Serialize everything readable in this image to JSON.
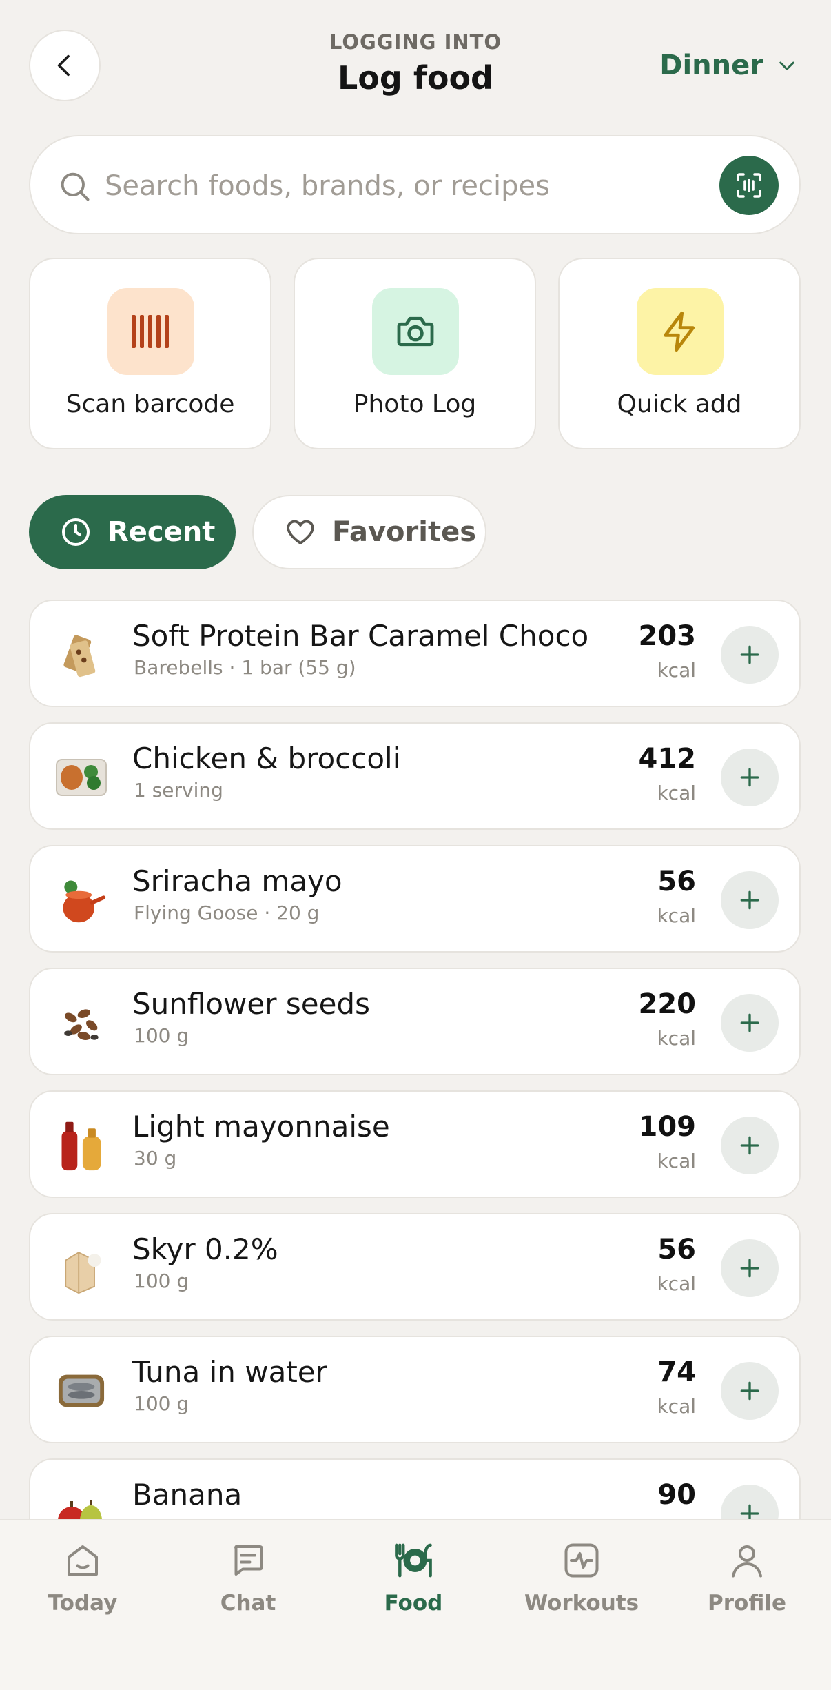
{
  "header": {
    "subtitle": "LOGGING INTO",
    "title": "Log food",
    "meal": "Dinner"
  },
  "search": {
    "placeholder": "Search foods, brands, or recipes"
  },
  "actions": [
    {
      "label": "Scan barcode",
      "icon": "barcode-icon"
    },
    {
      "label": "Photo Log",
      "icon": "camera-icon"
    },
    {
      "label": "Quick add",
      "icon": "lightning-icon"
    }
  ],
  "tabs": {
    "recent": "Recent",
    "favorites": "Favorites"
  },
  "foods": [
    {
      "name": "Soft Protein Bar Caramel Choco",
      "detail": "Barebells · 1 bar (55 g)",
      "kcal": "203",
      "unit": "kcal"
    },
    {
      "name": "Chicken & broccoli",
      "detail": "1 serving",
      "kcal": "412",
      "unit": "kcal"
    },
    {
      "name": "Sriracha mayo",
      "detail": "Flying Goose · 20 g",
      "kcal": "56",
      "unit": "kcal"
    },
    {
      "name": "Sunflower seeds",
      "detail": "100 g",
      "kcal": "220",
      "unit": "kcal"
    },
    {
      "name": "Light mayonnaise",
      "detail": "30 g",
      "kcal": "109",
      "unit": "kcal"
    },
    {
      "name": "Skyr 0.2%",
      "detail": "100 g",
      "kcal": "56",
      "unit": "kcal"
    },
    {
      "name": "Tuna in water",
      "detail": "100 g",
      "kcal": "74",
      "unit": "kcal"
    },
    {
      "name": "Banana",
      "detail": "",
      "kcal": "90",
      "unit": ""
    }
  ],
  "nav": {
    "today": "Today",
    "chat": "Chat",
    "food": "Food",
    "workouts": "Workouts",
    "profile": "Profile"
  },
  "colors": {
    "accent": "#2b6a4b",
    "background": "#f3f1ee"
  }
}
